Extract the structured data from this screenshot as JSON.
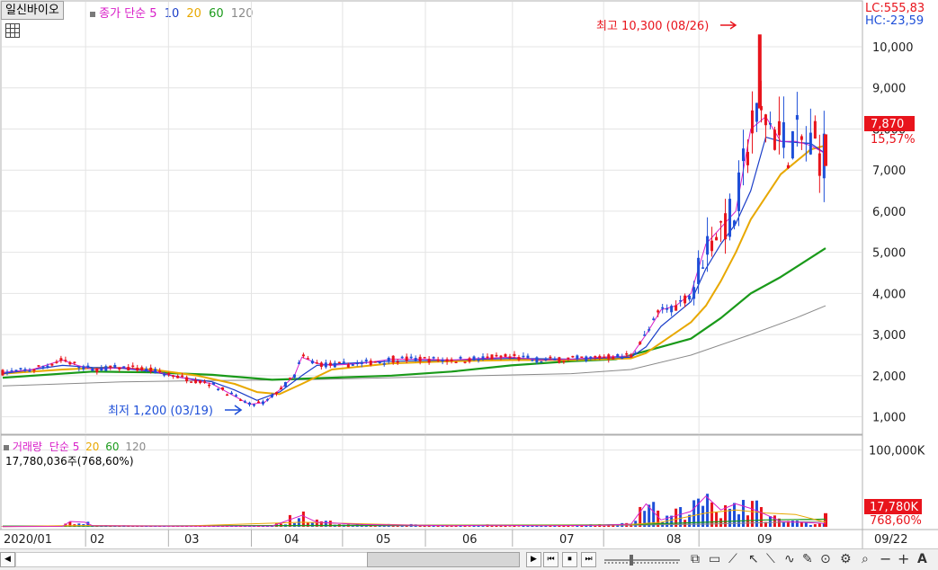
{
  "stock": {
    "name": "일신바이오"
  },
  "price_legend": {
    "title": "종가 단순",
    "periods": [
      {
        "label": "5",
        "color": "#d81ec8"
      },
      {
        "label": "10",
        "color": "#1a3dc8"
      },
      {
        "label": "20",
        "color": "#e8a800"
      },
      {
        "label": "60",
        "color": "#1a9a1a"
      },
      {
        "label": "120",
        "color": "#8a8a8a"
      }
    ]
  },
  "volume_legend": {
    "title": "거래량",
    "subtitle": "단순",
    "periods": [
      {
        "label": "5",
        "color": "#d81ec8"
      },
      {
        "label": "20",
        "color": "#e8a800"
      },
      {
        "label": "60",
        "color": "#1a9a1a"
      },
      {
        "label": "120",
        "color": "#8a8a8a"
      }
    ],
    "current": "17,780,036주(768,60%)"
  },
  "readouts": {
    "lc": "LC:555,83",
    "hc": "HC:-23,59",
    "price_tag": "7,870",
    "price_change": "15,57%",
    "volume_tag": "17,780K",
    "volume_change": "768,60%"
  },
  "colors": {
    "up": "#e8141c",
    "down": "#1e4fd8",
    "ma5": "#d81ec8",
    "ma10": "#1a3dc8",
    "ma20": "#e8a800",
    "ma60": "#1a9a1a",
    "ma120": "#8a8a8a"
  },
  "chart_data": [
    {
      "type": "candlestick",
      "name": "price",
      "x_ticks": [
        "2020/01",
        "02",
        "03",
        "04",
        "05",
        "06",
        "07",
        "08",
        "09"
      ],
      "x_last_label": "09/22",
      "y_ticks": [
        "1,000",
        "2,000",
        "3,000",
        "4,000",
        "5,000",
        "6,000",
        "7,000",
        "8,000",
        "9,000",
        "10,000"
      ],
      "ylim": [
        750,
        10700
      ],
      "annotations": [
        {
          "text": "최고 10,300 (08/26)",
          "type": "high",
          "value": 10300
        },
        {
          "text": "최저 1,200 (03/19)",
          "type": "low",
          "value": 1200
        }
      ],
      "last_close": 7870,
      "ma5": [
        [
          0,
          2080
        ],
        [
          20,
          2150
        ],
        [
          40,
          2380
        ],
        [
          50,
          2250
        ],
        [
          60,
          2150
        ],
        [
          80,
          2200
        ],
        [
          100,
          2120
        ],
        [
          120,
          1950
        ],
        [
          140,
          1800
        ],
        [
          155,
          1500
        ],
        [
          165,
          1300
        ],
        [
          175,
          1350
        ],
        [
          185,
          1650
        ],
        [
          195,
          2000
        ],
        [
          200,
          2450
        ],
        [
          210,
          2300
        ],
        [
          220,
          2250
        ],
        [
          240,
          2300
        ],
        [
          260,
          2400
        ],
        [
          280,
          2400
        ],
        [
          300,
          2380
        ],
        [
          320,
          2420
        ],
        [
          340,
          2450
        ],
        [
          360,
          2380
        ],
        [
          380,
          2400
        ],
        [
          400,
          2450
        ],
        [
          420,
          2480
        ],
        [
          430,
          3000
        ],
        [
          440,
          3600
        ],
        [
          450,
          3700
        ],
        [
          460,
          4000
        ],
        [
          470,
          5200
        ],
        [
          480,
          5600
        ],
        [
          490,
          6000
        ],
        [
          500,
          8000
        ],
        [
          510,
          8300
        ],
        [
          520,
          7700
        ],
        [
          530,
          7700
        ],
        [
          540,
          7600
        ],
        [
          550,
          7400
        ]
      ],
      "ma10": [
        [
          0,
          2050
        ],
        [
          40,
          2250
        ],
        [
          60,
          2200
        ],
        [
          80,
          2180
        ],
        [
          100,
          2100
        ],
        [
          120,
          1950
        ],
        [
          140,
          1850
        ],
        [
          155,
          1650
        ],
        [
          170,
          1400
        ],
        [
          185,
          1600
        ],
        [
          200,
          2000
        ],
        [
          210,
          2250
        ],
        [
          230,
          2300
        ],
        [
          260,
          2350
        ],
        [
          300,
          2380
        ],
        [
          340,
          2420
        ],
        [
          380,
          2400
        ],
        [
          420,
          2450
        ],
        [
          430,
          2700
        ],
        [
          440,
          3200
        ],
        [
          460,
          3800
        ],
        [
          470,
          4600
        ],
        [
          480,
          5200
        ],
        [
          490,
          5700
        ],
        [
          500,
          6500
        ],
        [
          510,
          7800
        ],
        [
          520,
          7700
        ],
        [
          540,
          7650
        ],
        [
          550,
          7400
        ]
      ],
      "ma20": [
        [
          0,
          2050
        ],
        [
          40,
          2150
        ],
        [
          70,
          2200
        ],
        [
          100,
          2150
        ],
        [
          130,
          2000
        ],
        [
          155,
          1800
        ],
        [
          170,
          1600
        ],
        [
          185,
          1550
        ],
        [
          200,
          1800
        ],
        [
          220,
          2150
        ],
        [
          260,
          2300
        ],
        [
          300,
          2350
        ],
        [
          340,
          2380
        ],
        [
          380,
          2380
        ],
        [
          420,
          2420
        ],
        [
          430,
          2550
        ],
        [
          440,
          2800
        ],
        [
          460,
          3300
        ],
        [
          470,
          3700
        ],
        [
          480,
          4300
        ],
        [
          490,
          5000
        ],
        [
          500,
          5800
        ],
        [
          520,
          6900
        ],
        [
          540,
          7500
        ],
        [
          550,
          7600
        ]
      ],
      "ma60": [
        [
          0,
          1950
        ],
        [
          60,
          2100
        ],
        [
          100,
          2080
        ],
        [
          140,
          2020
        ],
        [
          180,
          1900
        ],
        [
          220,
          1950
        ],
        [
          260,
          2000
        ],
        [
          300,
          2100
        ],
        [
          340,
          2250
        ],
        [
          380,
          2350
        ],
        [
          410,
          2400
        ],
        [
          430,
          2600
        ],
        [
          460,
          2900
        ],
        [
          480,
          3400
        ],
        [
          500,
          4000
        ],
        [
          520,
          4400
        ],
        [
          550,
          5100
        ]
      ],
      "ma120": [
        [
          0,
          1750
        ],
        [
          80,
          1850
        ],
        [
          140,
          1880
        ],
        [
          200,
          1900
        ],
        [
          260,
          1950
        ],
        [
          320,
          2000
        ],
        [
          380,
          2050
        ],
        [
          420,
          2150
        ],
        [
          460,
          2500
        ],
        [
          500,
          3000
        ],
        [
          530,
          3400
        ],
        [
          550,
          3700
        ]
      ]
    },
    {
      "type": "bar",
      "name": "volume",
      "y_ticks": [
        "100,000K"
      ],
      "ylim": [
        0,
        110000
      ],
      "unit": "K",
      "last_value": 17780,
      "ma5": [
        [
          0,
          400
        ],
        [
          40,
          600
        ],
        [
          45,
          7000
        ],
        [
          55,
          6000
        ],
        [
          60,
          1500
        ],
        [
          100,
          1000
        ],
        [
          140,
          800
        ],
        [
          180,
          1000
        ],
        [
          200,
          15000
        ],
        [
          210,
          6000
        ],
        [
          240,
          3000
        ],
        [
          300,
          1500
        ],
        [
          330,
          2000
        ],
        [
          360,
          1500
        ],
        [
          400,
          2000
        ],
        [
          420,
          3500
        ],
        [
          430,
          30000
        ],
        [
          440,
          9000
        ],
        [
          460,
          20000
        ],
        [
          470,
          40000
        ],
        [
          480,
          22000
        ],
        [
          490,
          30000
        ],
        [
          500,
          24000
        ],
        [
          510,
          16000
        ],
        [
          520,
          7000
        ],
        [
          550,
          4500
        ]
      ],
      "ma20": [
        [
          0,
          400
        ],
        [
          40,
          1500
        ],
        [
          60,
          1800
        ],
        [
          120,
          1000
        ],
        [
          200,
          6000
        ],
        [
          240,
          4000
        ],
        [
          280,
          2000
        ],
        [
          340,
          2000
        ],
        [
          400,
          2000
        ],
        [
          420,
          3000
        ],
        [
          440,
          6000
        ],
        [
          470,
          18000
        ],
        [
          490,
          22000
        ],
        [
          510,
          18000
        ],
        [
          530,
          16000
        ],
        [
          550,
          6000
        ]
      ],
      "ma60": [
        [
          0,
          900
        ],
        [
          100,
          1200
        ],
        [
          200,
          1800
        ],
        [
          300,
          2200
        ],
        [
          400,
          2500
        ],
        [
          430,
          3500
        ],
        [
          470,
          6000
        ],
        [
          510,
          9000
        ],
        [
          550,
          10000
        ]
      ],
      "ma120": [
        [
          0,
          800
        ],
        [
          200,
          1300
        ],
        [
          350,
          1800
        ],
        [
          420,
          2200
        ],
        [
          470,
          3500
        ],
        [
          520,
          6000
        ],
        [
          550,
          7000
        ]
      ]
    }
  ],
  "scroll_controls": [
    "◀",
    "▶",
    "⏮",
    "⏹",
    "⏭"
  ],
  "toolbar_icons": [
    "rect-select",
    "window",
    "line",
    "zoom",
    "minus",
    "plus",
    "A"
  ]
}
